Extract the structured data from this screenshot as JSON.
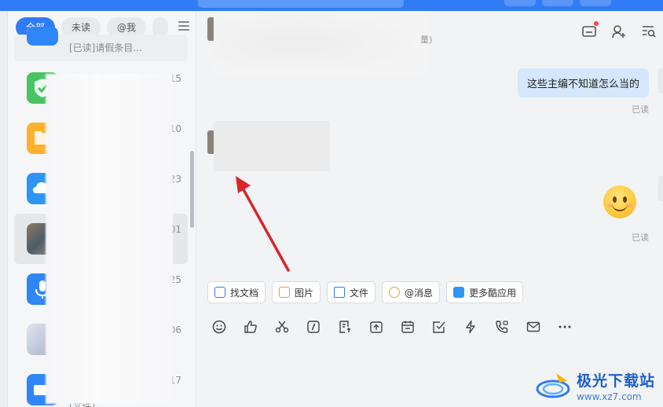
{
  "filters": {
    "all": "全部",
    "unread": "未读",
    "at_me": "@我"
  },
  "conversations": [
    {
      "preview": "[已读]请假条目...",
      "color": "#2f86f6"
    },
    {
      "time": "15",
      "color": "#3ec25a"
    },
    {
      "time": "10",
      "color": "#ffb02e"
    },
    {
      "time": "23",
      "color": "#2f95f5"
    },
    {
      "time": "01",
      "color": "#6e6a5e"
    },
    {
      "time": "25",
      "color": "#2f86f6"
    },
    {
      "time": "06",
      "color": "#c0c6d6"
    },
    {
      "time": "17",
      "preview": "[文件]",
      "color": "#2f86f6"
    }
  ],
  "chat": {
    "header_sub": "量)",
    "message_text": "这些主编不知道怎么当的",
    "read_status_1": "已读",
    "read_status_2": "已读"
  },
  "quick_actions": {
    "find_doc": "找文档",
    "image": "图片",
    "file": "文件",
    "mention": "@消息",
    "more_apps": "更多酷应用"
  },
  "watermark": {
    "name": "极光下载站",
    "url": "www.xz7.com"
  },
  "colors": {
    "brand_blue": "#2f7cf6",
    "bubble": "#d4e7fc",
    "arrow": "#d9262a"
  }
}
